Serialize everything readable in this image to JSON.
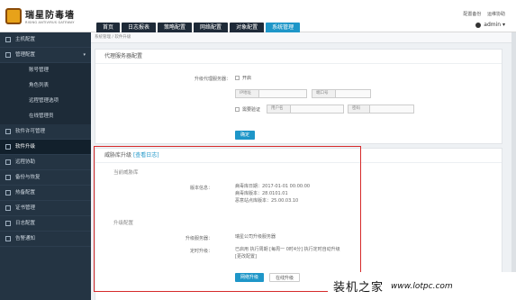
{
  "brand": {
    "title": "瑞星防毒墙",
    "subtitle": "RISING ANTIVIRUS GATEWAY"
  },
  "top_links": [
    "配置备份",
    "运维协助"
  ],
  "user": {
    "name": "admin ▾"
  },
  "nav_tabs": [
    "首页",
    "日志报表",
    "策略配置",
    "网络配置",
    "对象配置",
    "系统管理"
  ],
  "nav_active_index": 5,
  "sidebar": [
    {
      "label": "主机配置"
    },
    {
      "label": "管理配置",
      "caret": "▾"
    },
    {
      "label": "账号管理",
      "sub": true
    },
    {
      "label": "角色列表",
      "sub": true
    },
    {
      "label": "远程管理选项",
      "sub": true
    },
    {
      "label": "在线管理员",
      "sub": true
    },
    {
      "label": "软件许可管理"
    },
    {
      "label": "软件升级",
      "active": true
    },
    {
      "label": "远程协助"
    },
    {
      "label": "备份与恢复"
    },
    {
      "label": "热备配置"
    },
    {
      "label": "证书管理"
    },
    {
      "label": "日志配置"
    },
    {
      "label": "告警通知"
    }
  ],
  "breadcrumb": "系统管理 / 软件升级",
  "proxy": {
    "title": "代理服务器配置",
    "enable_label": "升级代理服务器：",
    "enable_value": "开启",
    "ip_label": "IP地址",
    "port_label": "端口号",
    "auth_label": "需要验证",
    "user_label": "用户名",
    "pass_label": "密码",
    "confirm": "确定"
  },
  "upgrade": {
    "title": "威胁库升级",
    "log_link": "[查看日志]",
    "current_section": "当前威胁库",
    "version_label": "版本信息：",
    "version_lines": [
      "病毒库日期：2017-01-01 00:00:00",
      "病毒库版本：28.0101.01",
      "恶意站点库版本：25.00.03.10"
    ],
    "config_section": "升级配置",
    "server_label": "升级服务器：",
    "server_value": "瑞星公司升级服务器",
    "schedule_label": "定时升级：",
    "schedule_value": "已启用 执行周期 [每周一 0时4分] 执行定时自动升级",
    "change_link": "[更改配置]",
    "btn_upgrade": "网络升级",
    "btn_offline": "在线升级"
  },
  "watermark": {
    "cn": "装机之家",
    "url": "www.lotpc.com"
  },
  "colors": {
    "accent": "#1e96c8",
    "sidebar": "#243443",
    "highlight": "#d62a2a"
  }
}
